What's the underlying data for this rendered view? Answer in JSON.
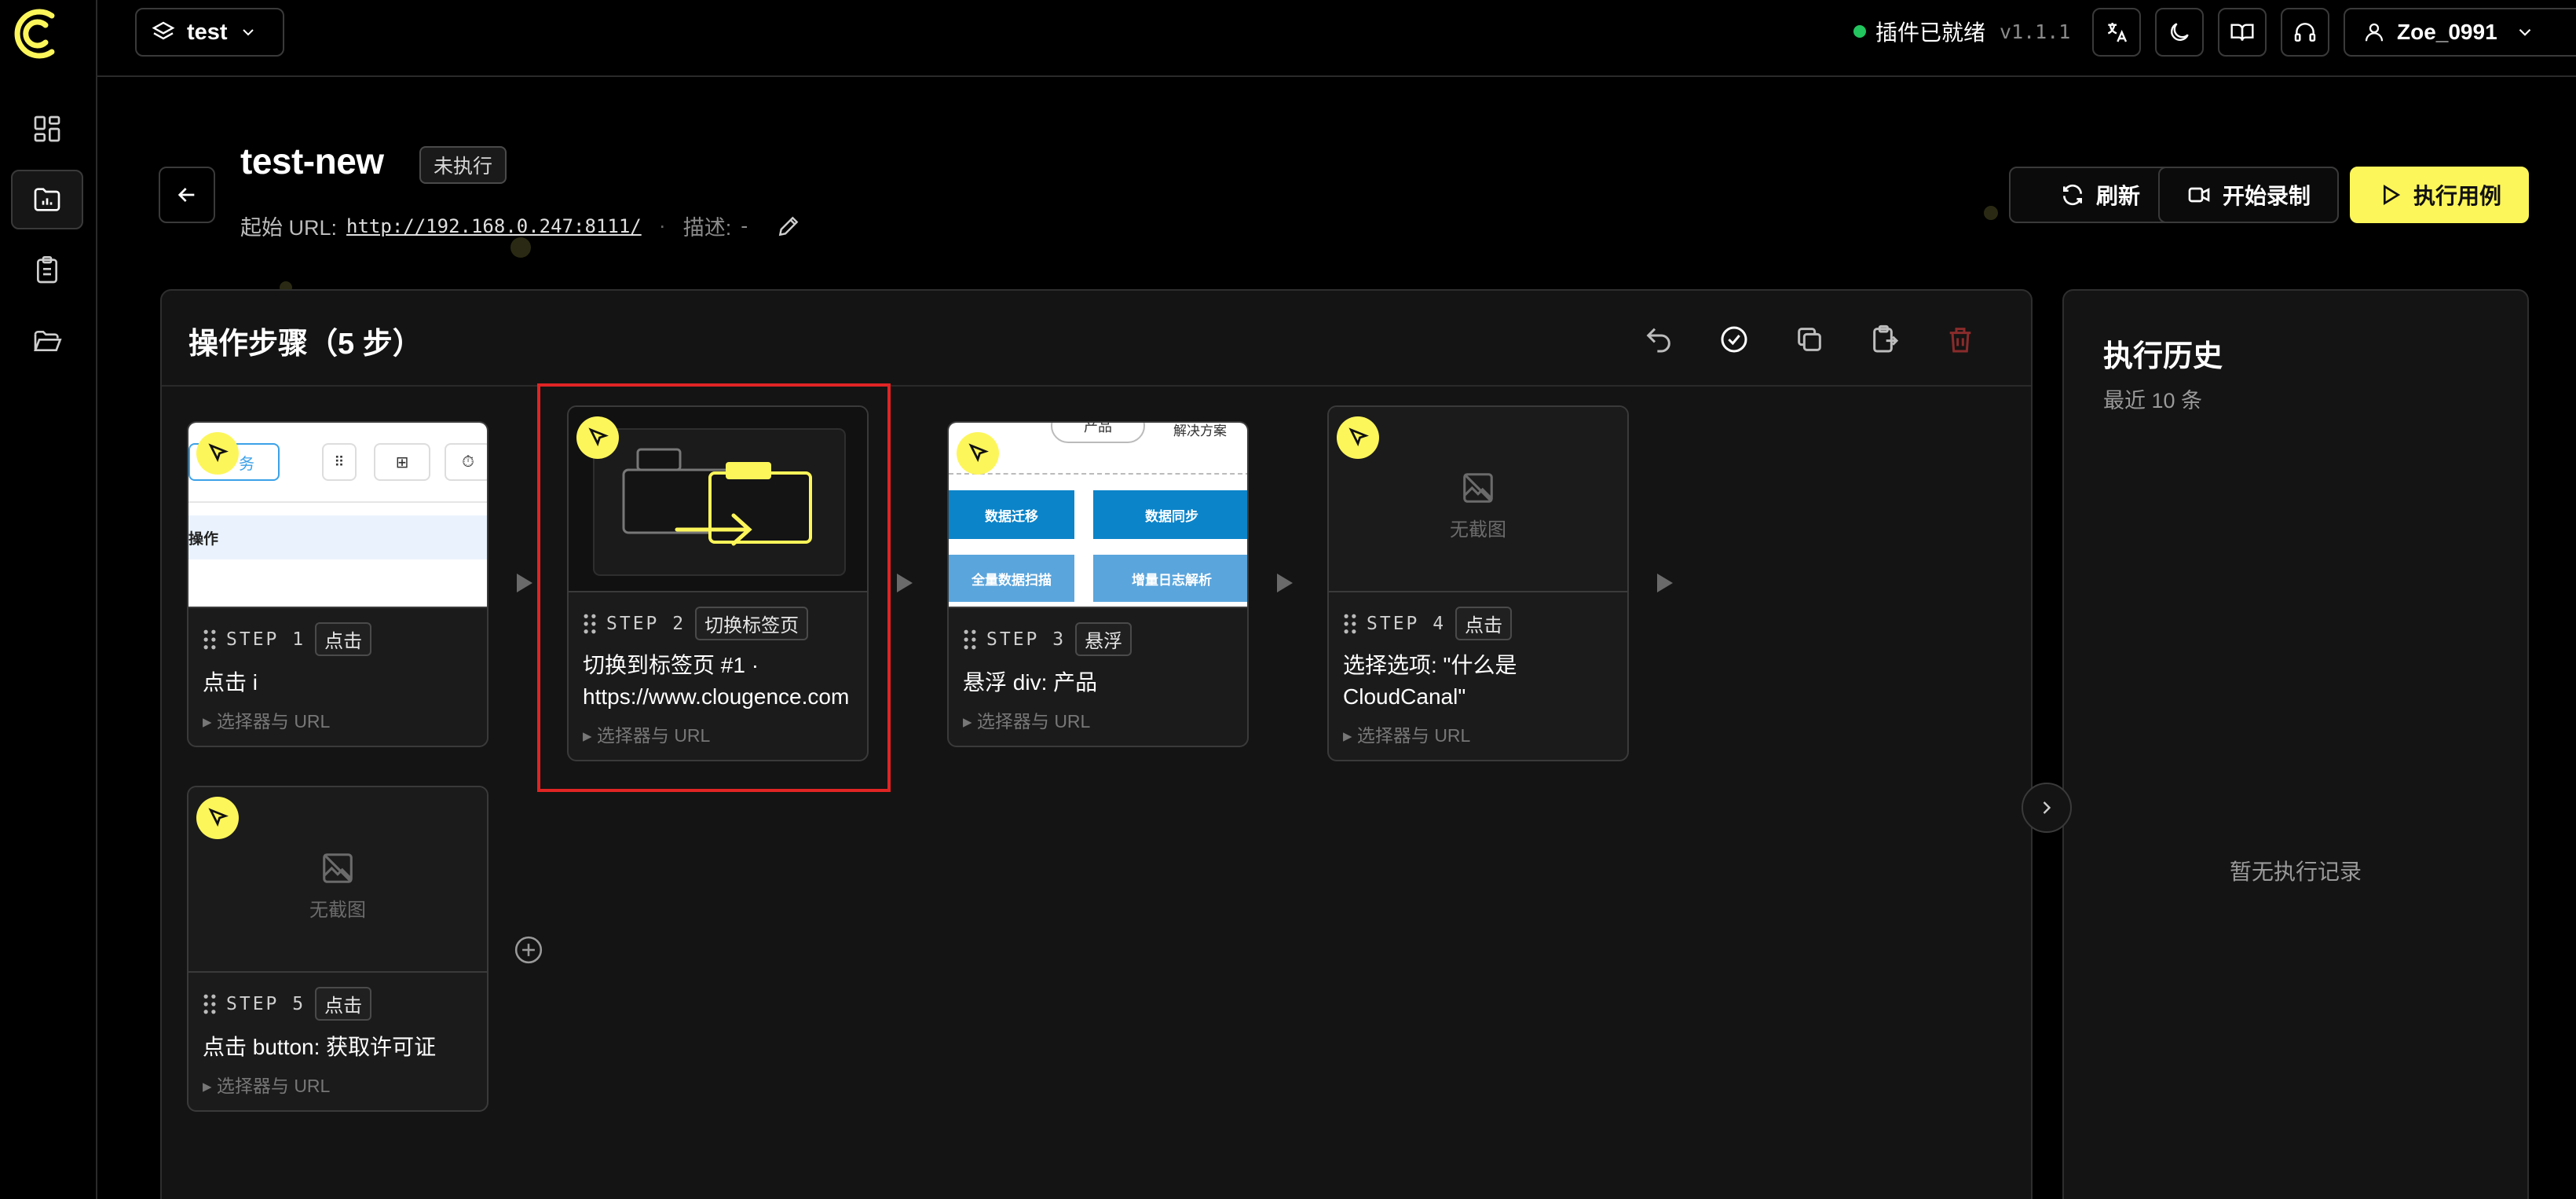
{
  "app": {
    "logo": "cloudcanal-logo"
  },
  "sidebar": {
    "items": [
      {
        "icon": "dashboard-icon",
        "active": false
      },
      {
        "icon": "folder-chart-icon",
        "active": true
      },
      {
        "icon": "clipboard-icon",
        "active": false
      },
      {
        "icon": "folder-open-icon",
        "active": false
      }
    ]
  },
  "topbar": {
    "project": "test",
    "status_text": "插件已就绪",
    "version": "v1.1.1",
    "status_color": "#22c55e",
    "icons": [
      "translate-icon",
      "moon-icon",
      "book-icon",
      "headset-icon"
    ],
    "user": "Zoe_0991"
  },
  "header": {
    "title": "test-new",
    "state": "未执行",
    "start_url_label": "起始 URL:",
    "start_url": "http://192.168.0.247:8111/",
    "separator": "·",
    "desc_label": "描述:",
    "desc_value": "-",
    "buttons": {
      "refresh": "刷新",
      "record": "开始录制",
      "run": "执行用例"
    },
    "accent": "#fdf65a"
  },
  "steps_panel": {
    "title": "操作步骤（5 步）",
    "tools": [
      "undo-icon",
      "check-circle-icon",
      "copy-icon",
      "clipboard-export-icon",
      "trash-icon"
    ],
    "no_snapshot": "无截图",
    "selector_toggle": "▸ 选择器与 URL",
    "steps": [
      {
        "label": "STEP 1",
        "type": "点击",
        "text": "点击 i",
        "has_snapshot": true
      },
      {
        "label": "STEP 2",
        "type": "切换标签页",
        "text_line1": "切换到标签页 #1 ·",
        "text_line2": "https://www.clougence.com",
        "has_snapshot": true,
        "selected": true
      },
      {
        "label": "STEP 3",
        "type": "悬浮",
        "text": "悬浮 div: 产品",
        "has_snapshot": true
      },
      {
        "label": "STEP 4",
        "type": "点击",
        "text_line1": "选择选项: \"什么是",
        "text_line2": "CloudCanal\"",
        "has_snapshot": false
      },
      {
        "label": "STEP 5",
        "type": "点击",
        "text": "点击 button: 获取许可证",
        "has_snapshot": false
      }
    ],
    "thumb1": {
      "tab": "务",
      "row": "操作"
    },
    "thumb3": {
      "nav1": "产品",
      "nav2": "解决方案",
      "tiles": [
        "数据迁移",
        "数据同步",
        "全量数据扫描",
        "增量日志解析"
      ]
    }
  },
  "history": {
    "title": "执行历史",
    "subtitle": "最近 10 条",
    "empty": "暂无执行记录"
  }
}
